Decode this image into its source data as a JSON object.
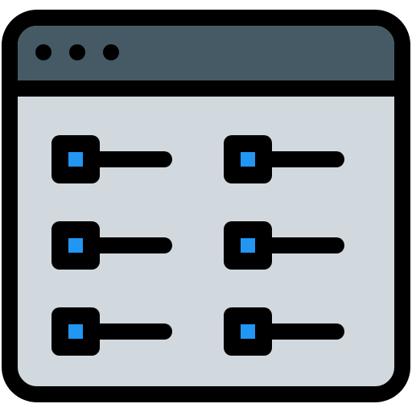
{
  "window": {
    "title_dots": [
      "dot-1",
      "dot-2",
      "dot-3"
    ]
  },
  "colors": {
    "titlebar": "#455a64",
    "content_bg": "#d1d9de",
    "outline": "#000000",
    "check_accent": "#2196f3"
  },
  "options": [
    {
      "id": "option-1",
      "checked": true
    },
    {
      "id": "option-2",
      "checked": true
    },
    {
      "id": "option-3",
      "checked": true
    },
    {
      "id": "option-4",
      "checked": true
    },
    {
      "id": "option-5",
      "checked": true
    },
    {
      "id": "option-6",
      "checked": true
    }
  ],
  "icons": [
    "window-dot-icon",
    "checkbox-checked-icon",
    "option-line-icon"
  ]
}
